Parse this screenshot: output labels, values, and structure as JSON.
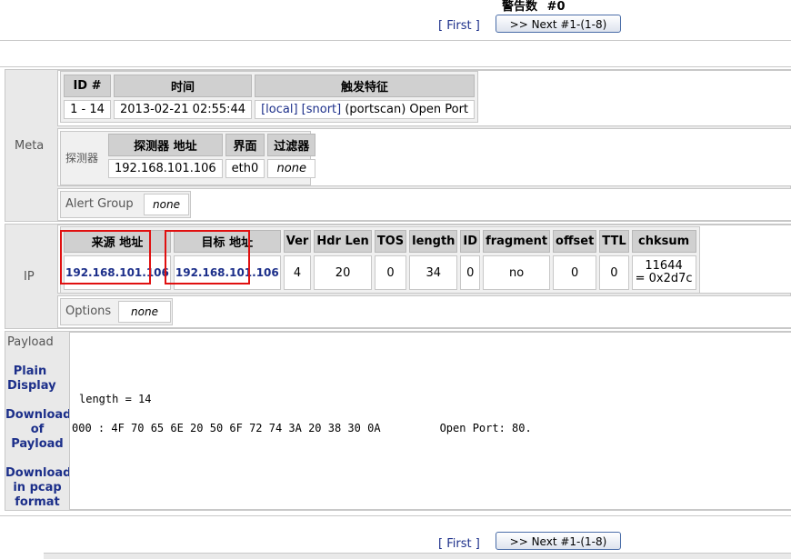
{
  "header": {
    "alert_count_label": "警告数",
    "alert_count_value": "#0"
  },
  "nav": {
    "first": "[ First ]",
    "next": ">> Next #1-(1-8)"
  },
  "meta": {
    "label": "Meta",
    "headers": [
      "ID #",
      "时间",
      "触发特征"
    ],
    "id": "1 - 14",
    "time": "2013-02-21 02:55:44",
    "sig_local": "[local]",
    "sig_snort": "[snort]",
    "sig_text": "(portscan) Open Port",
    "sensor_label": "探测器",
    "sensor_headers": [
      "探测器 地址",
      "界面",
      "过滤器"
    ],
    "sensor_address": "192.168.101.106",
    "sensor_interface": "eth0",
    "sensor_filter": "none",
    "alert_group_label": "Alert Group",
    "alert_group_value": "none"
  },
  "ip": {
    "label": "IP",
    "headers": [
      "来源 地址",
      "目标 地址",
      "Ver",
      "Hdr Len",
      "TOS",
      "length",
      "ID",
      "fragment",
      "offset",
      "TTL",
      "chksum"
    ],
    "src": "192.168.101.106",
    "dst": "192.168.101.106",
    "ver": "4",
    "hdr_len": "20",
    "tos": "0",
    "length": "34",
    "id": "0",
    "fragment": "no",
    "offset": "0",
    "ttl": "0",
    "chksum_dec": "11644",
    "chksum_hex": "= 0x2d7c",
    "options_label": "Options",
    "options_value": "none"
  },
  "payload": {
    "label": "Payload",
    "plain_display": "Plain Display",
    "download_payload": "Download of Payload",
    "download_pcap": "Download in pcap format",
    "length_line": "length = 14",
    "hex_line": "000 : 4F 70 65 6E 20 50 6F 72 74 3A 20 38 30 0A         Open Port: 80."
  },
  "accent_colors": {
    "link": "#1c2f8a",
    "highlight_box": "#e01010"
  }
}
